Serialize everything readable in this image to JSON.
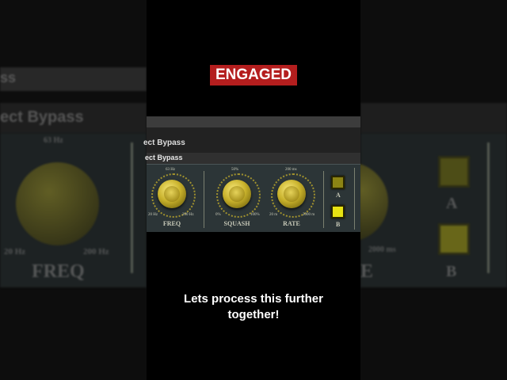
{
  "badge": {
    "text": "ENGAGED"
  },
  "plugin": {
    "header_label": "ect Bypass",
    "section_label": "ect Bypass",
    "knobs": [
      {
        "label": "FREQ",
        "top_value": "63 Hz",
        "min": "20 Hz",
        "max": "200 Hz"
      },
      {
        "label": "SQUASH",
        "top_value": "50%",
        "min": "0%",
        "max": "100%"
      },
      {
        "label": "RATE",
        "top_value": "200 ms",
        "min": "20 m",
        "max": "2000 m"
      }
    ],
    "buttons": [
      {
        "label": "A",
        "state": "off"
      },
      {
        "label": "B",
        "state": "on"
      }
    ]
  },
  "bg_left": {
    "header": "ect Bypass",
    "topleft": "ss",
    "freq_label": "FREQ",
    "top_value": "63 Hz",
    "min": "20 Hz",
    "max": "200 Hz"
  },
  "bg_right": {
    "label_a": "A",
    "label_b": "B",
    "max": "2000 ms",
    "partial": "E"
  },
  "caption": {
    "line1": "Lets process this further",
    "line2": "together!"
  },
  "colors": {
    "badge": "#b41e1e",
    "panel": "#2c3537",
    "knob": "#c9b22c",
    "button_on": "#e8e313"
  }
}
